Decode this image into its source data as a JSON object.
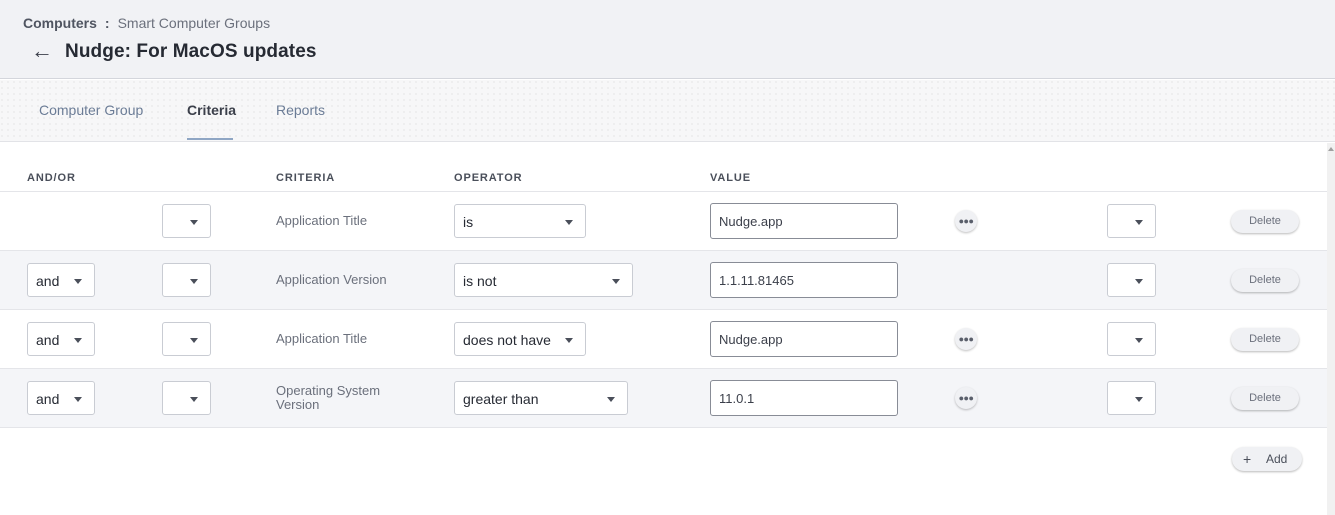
{
  "breadcrumb": {
    "root": "Computers",
    "separator": ":",
    "current": "Smart Computer Groups"
  },
  "page_title": "Nudge: For MacOS updates",
  "tabs": [
    {
      "label": "Computer Group",
      "active": false
    },
    {
      "label": "Criteria",
      "active": true
    },
    {
      "label": "Reports",
      "active": false
    }
  ],
  "table": {
    "headers": {
      "and_or": "AND/OR",
      "criteria": "CRITERIA",
      "operator": "OPERATOR",
      "value": "VALUE"
    },
    "rows": [
      {
        "and_or": "",
        "paren_open": "",
        "criteria": "Application Title",
        "operator": "is",
        "value": "Nudge.app",
        "has_more": true,
        "paren_close": "",
        "delete_label": "Delete"
      },
      {
        "and_or": "and",
        "paren_open": "",
        "criteria": "Application Version",
        "operator": "is not",
        "value": "1.1.11.81465",
        "has_more": false,
        "paren_close": "",
        "delete_label": "Delete"
      },
      {
        "and_or": "and",
        "paren_open": "",
        "criteria": "Application Title",
        "operator": "does not have",
        "value": "Nudge.app",
        "has_more": true,
        "paren_close": "",
        "delete_label": "Delete"
      },
      {
        "and_or": "and",
        "paren_open": "",
        "criteria": "Operating System Version",
        "operator": "greater than",
        "value": "11.0.1",
        "has_more": true,
        "paren_close": "",
        "delete_label": "Delete"
      }
    ]
  },
  "add_button": {
    "icon": "plus-icon",
    "label": "Add"
  },
  "more_icon": "ellipsis-icon",
  "colors": {
    "header_bg": "#f1f2f5",
    "active_tab_underline": "#8fa6c4",
    "tab_link": "#6b7c96",
    "alt_row_bg": "#f4f5f8"
  }
}
